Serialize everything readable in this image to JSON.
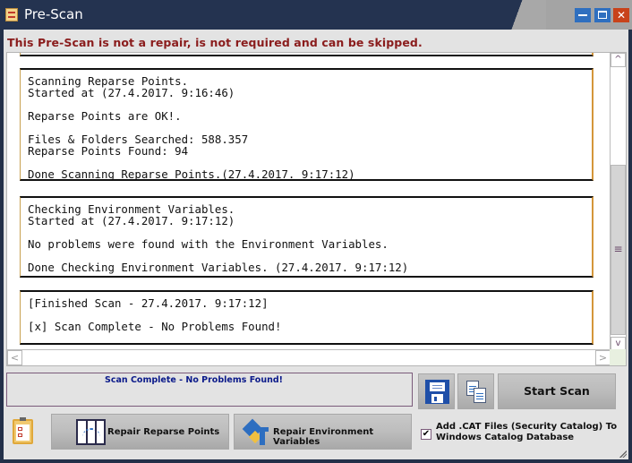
{
  "window": {
    "title": "Pre-Scan",
    "controls": {
      "minimize": "minimize",
      "maximize": "maximize",
      "close": "close"
    }
  },
  "warning": "This Pre-Scan is not a repair, is not required and can be skipped.",
  "log": {
    "blocks": [
      {
        "lines": [
          "Scanning Reparse Points.",
          "Started at (27.4.2017. 9:16:46)",
          "",
          "Reparse Points are OK!.",
          "",
          "Files & Folders Searched: 588.357",
          "Reparse Points Found: 94",
          "",
          "Done Scanning Reparse Points.(27.4.2017. 9:17:12)"
        ]
      },
      {
        "lines": [
          "Checking Environment Variables.",
          "Started at (27.4.2017. 9:17:12)",
          "",
          "No problems were found with the Environment Variables.",
          "",
          "Done Checking Environment Variables. (27.4.2017. 9:17:12)"
        ]
      },
      {
        "lines": [
          "[Finished Scan - 27.4.2017. 9:17:12]",
          "",
          "[x] Scan Complete - No Problems Found!"
        ]
      }
    ],
    "scroll_up_glyph": "^",
    "scroll_down_glyph": "v",
    "scroll_left_glyph": "<",
    "scroll_right_glyph": ">",
    "thumb_glyph": "≡"
  },
  "status": {
    "message": "Scan Complete - No Problems Found!"
  },
  "toolbar": {
    "save_icon": "floppy-disk-icon",
    "copy_icon": "copy-documents-icon",
    "start_scan_label": "Start Scan"
  },
  "bottom": {
    "checklist_icon": "clipboard-checklist-icon",
    "repair_reparse_label": "Repair Reparse Points",
    "repair_env_label": "Repair Environment Variables",
    "cat_checkbox": {
      "checked": true,
      "glyph": "✔",
      "label_line1": "Add .CAT Files (Security Catalog) To",
      "label_line2": "Windows Catalog Database"
    }
  },
  "colors": {
    "titlebar": "#243350",
    "warning_text": "#8a1c1c",
    "status_text": "#0b1a8a",
    "close_button": "#c8421a",
    "window_buttons": "#2f6fbf"
  }
}
